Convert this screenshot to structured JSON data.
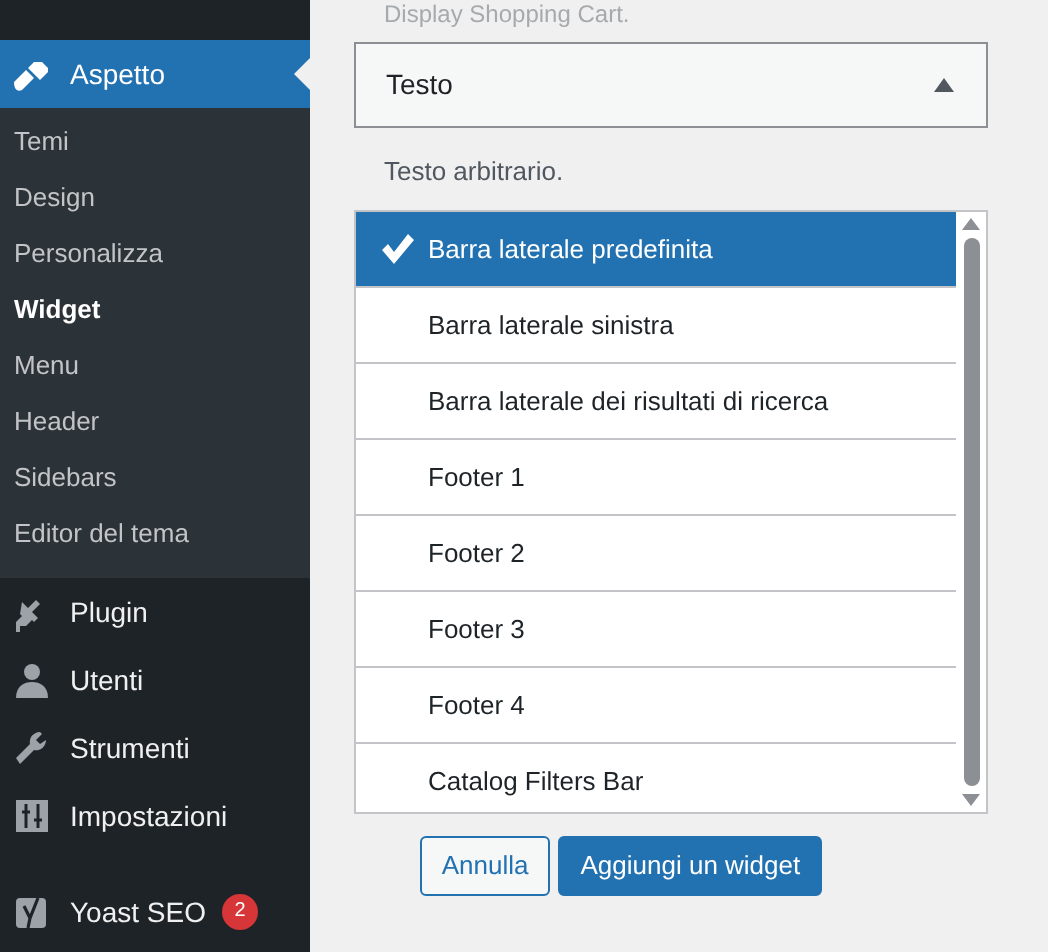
{
  "sidebar": {
    "menu": [
      {
        "label": "Aspetto",
        "selected": true,
        "children": [
          {
            "label": "Temi",
            "selected": false
          },
          {
            "label": "Design",
            "selected": false
          },
          {
            "label": "Personalizza",
            "selected": false
          },
          {
            "label": "Widget",
            "selected": true
          },
          {
            "label": "Menu",
            "selected": false
          },
          {
            "label": "Header",
            "selected": false
          },
          {
            "label": "Sidebars",
            "selected": false
          },
          {
            "label": "Editor del tema",
            "selected": false
          }
        ]
      },
      {
        "label": "Plugin",
        "selected": false
      },
      {
        "label": "Utenti",
        "selected": false
      },
      {
        "label": "Strumenti",
        "selected": false
      },
      {
        "label": "Impostazioni",
        "selected": false
      },
      {
        "label": "Yoast SEO",
        "selected": false,
        "badge": "2"
      }
    ]
  },
  "main": {
    "previous_description": "Display Shopping Cart.",
    "widget": {
      "title": "Testo",
      "expanded": true,
      "description": "Testo arbitrario."
    },
    "sidebar_choices": [
      {
        "label": "Barra laterale predefinita",
        "selected": true
      },
      {
        "label": "Barra laterale sinistra",
        "selected": false
      },
      {
        "label": "Barra laterale dei risultati di ricerca",
        "selected": false
      },
      {
        "label": "Footer 1",
        "selected": false
      },
      {
        "label": "Footer 2",
        "selected": false
      },
      {
        "label": "Footer 3",
        "selected": false
      },
      {
        "label": "Footer 4",
        "selected": false
      },
      {
        "label": "Catalog Filters Bar",
        "selected": false
      }
    ],
    "buttons": [
      {
        "label": "Annulla",
        "kind": "secondary"
      },
      {
        "label": "Aggiungi un widget",
        "kind": "primary"
      }
    ]
  }
}
